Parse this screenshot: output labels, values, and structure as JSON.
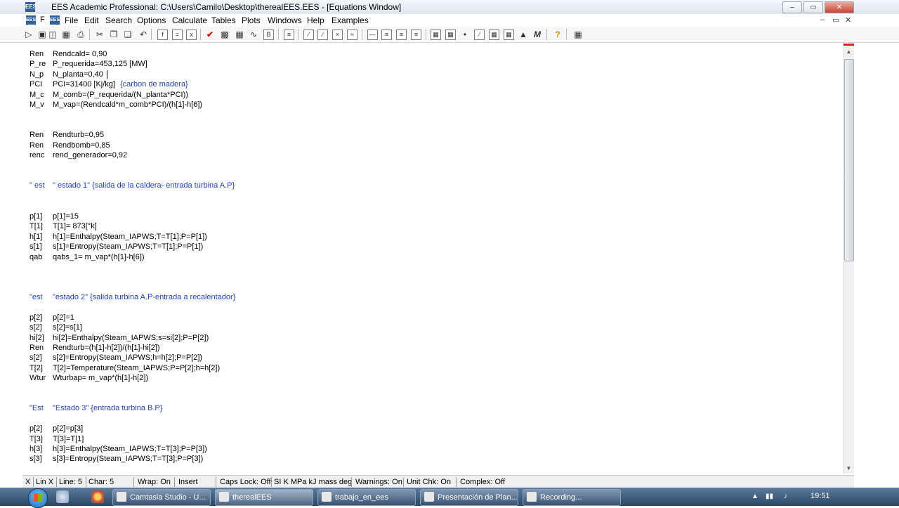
{
  "window": {
    "title": "EES Academic Professional:  C:\\Users\\Camilo\\Desktop\\therealEES.EES - [Equations Window]",
    "app_icon_text": "EES",
    "buttons": {
      "minimize": "–",
      "maximize": "▭",
      "close": "✕"
    }
  },
  "menubar": {
    "left_icon_text": "F",
    "items": [
      "File",
      "Edit",
      "Search",
      "Options",
      "Calculate",
      "Tables",
      "Plots",
      "Windows",
      "Help",
      "Examples"
    ],
    "mdi_buttons": [
      "–",
      "▭",
      "✕"
    ]
  },
  "toolbar": {
    "icons": [
      "open-icon",
      "new-icon",
      "open-folder-icon",
      "save-icon",
      "print-icon",
      "cut-icon",
      "copy-icon",
      "paste-icon",
      "undo-icon",
      "format-icon",
      "equations-icon",
      "formatted-equations-icon",
      "solution-icon",
      "check-icon",
      "calculator-icon",
      "solve-table-icon",
      "min-max-icon",
      "arrays-icon",
      "parametric-icon",
      "plot-icon",
      "plot-new-icon",
      "overlay-plot-icon",
      "property-plot-icon",
      "integral-icon",
      "lookup-icon",
      "array-table-icon",
      "residuals-icon",
      "diagram-icon",
      "table-icon",
      "parametric-table-icon",
      "alter-values-icon",
      "grid-icon",
      "plot-window-icon",
      "diagram-window-icon",
      "chart-icon",
      "macro-icon",
      "help-icon",
      "report-icon"
    ],
    "glyphs": {
      "check": "✔",
      "help": "?",
      "macro": "M"
    }
  },
  "editor": {
    "lines": [
      {
        "name": "Ren",
        "eq": "Rendcald= 0,90"
      },
      {
        "name": "P_re",
        "eq": "P_requerida=453,125 [MW]"
      },
      {
        "name": "N_p",
        "eq": "N_planta=0,40"
      },
      {
        "name": "PCI",
        "eq": "PCI=31400 [Kj/kg]",
        "comment": "{carbon de madera}"
      },
      {
        "name": "M_c",
        "eq": "M_comb=(P_requerida/(N_planta*PCI))"
      },
      {
        "name": "M_v",
        "eq": "M_vap=(Rendcald*m_comb*PCI)/(h[1]-h[6])"
      },
      {
        "name": "Ren",
        "eq": "Rendturb=0,95"
      },
      {
        "name": "Ren",
        "eq": "Rendbomb=0,85"
      },
      {
        "name": "renc",
        "eq": "rend_generador=0,92"
      },
      {
        "name": "\" est",
        "eq": "\" estado 1\" {salida de la caldera- entrada turbina A.P}"
      },
      {
        "name": "p[1]",
        "eq": "p[1]=15"
      },
      {
        "name": "T[1]",
        "eq": "T[1]= 873[°k]"
      },
      {
        "name": "h[1]",
        "eq": "h[1]=Enthalpy(Steam_IAPWS;T=T[1];P=P[1])"
      },
      {
        "name": "s[1]",
        "eq": "s[1]=Entropy(Steam_IAPWS;T=T[1];P=P[1])"
      },
      {
        "name": "qab",
        "eq": "qabs_1= m_vap*(h[1]-h[6])"
      },
      {
        "name": "\"est",
        "eq": "\"estado 2\" {salida turbina A.P-entrada a recalentador}"
      },
      {
        "name": "p[2]",
        "eq": "p[2]=1"
      },
      {
        "name": "s[2]",
        "eq": "s[2]=s[1]"
      },
      {
        "name": "hi[2]",
        "eq": "hi[2]=Enthalpy(Steam_IAPWS;s=si[2];P=P[2])"
      },
      {
        "name": "Ren",
        "eq": "Rendturb=(h[1]-h[2])/(h[1]-hi[2])"
      },
      {
        "name": "s[2]",
        "eq": "s[2]=Entropy(Steam_IAPWS;h=h[2];P=P[2])"
      },
      {
        "name": "T[2]",
        "eq": "T[2]=Temperature(Steam_IAPWS;P=P[2];h=h[2])"
      },
      {
        "name": "Wtur",
        "eq": "Wturbap= m_vap*(h[1]-h[2])"
      },
      {
        "name": "\"Est",
        "eq": "\"Estado 3\" {entrada turbina B.P}"
      },
      {
        "name": "p[2]",
        "eq": "p[2]=p[3]"
      },
      {
        "name": "T[3]",
        "eq": "T[3]=T[1]"
      },
      {
        "name": "h[3]",
        "eq": "h[3]=Enthalpy(Steam_IAPWS;T=T[3];P=P[3])"
      },
      {
        "name": "s[3]",
        "eq": "s[3]=Entropy(Steam_IAPWS;T=T[3];P=P[3])"
      }
    ]
  },
  "statusbar": {
    "items": [
      "X",
      "Lin X",
      "Line: 5",
      "Char: 5",
      "Wrap: On",
      "Insert",
      "Caps Lock: Off",
      "SI K MPa kJ mass deg",
      "Warnings: On",
      "Unit Chk: On",
      "Complex: Off"
    ]
  },
  "taskbar": {
    "tasks": [
      {
        "label": "Camtasia Studio - U..."
      },
      {
        "label": "therealEES"
      },
      {
        "label": "trabajo_en_ees"
      },
      {
        "label": "Presentación de Plan..."
      },
      {
        "label": "Recording..."
      }
    ],
    "clock": "19:51"
  }
}
